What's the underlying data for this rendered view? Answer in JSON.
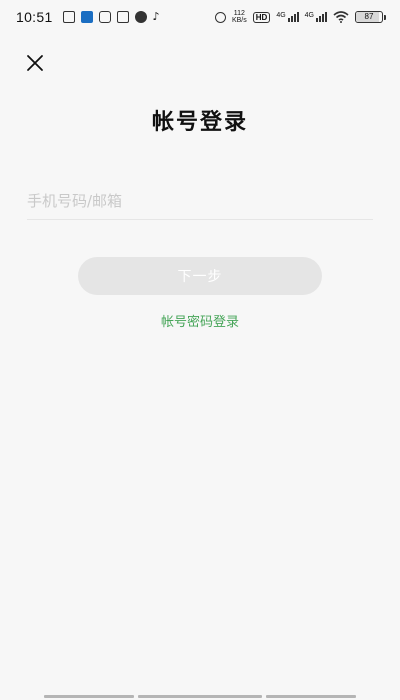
{
  "status_bar": {
    "time": "10:51",
    "net_speed_value": "112",
    "net_speed_unit": "KB/s",
    "hd_badge": "HD",
    "signal1_label": "4G",
    "signal2_label": "4G",
    "battery_level": "87",
    "notification_icons": [
      "app-icon",
      "app-icon",
      "gallery-icon",
      "app-icon",
      "app-icon",
      "tiktok-icon"
    ]
  },
  "header": {
    "title": "帐号登录"
  },
  "form": {
    "phone_placeholder": "手机号码/邮箱",
    "next_label": "下一步",
    "password_login_label": "帐号密码登录"
  },
  "colors": {
    "accent_green": "#46a558",
    "button_disabled": "#e5e5e5",
    "background": "#f7f7f7"
  }
}
